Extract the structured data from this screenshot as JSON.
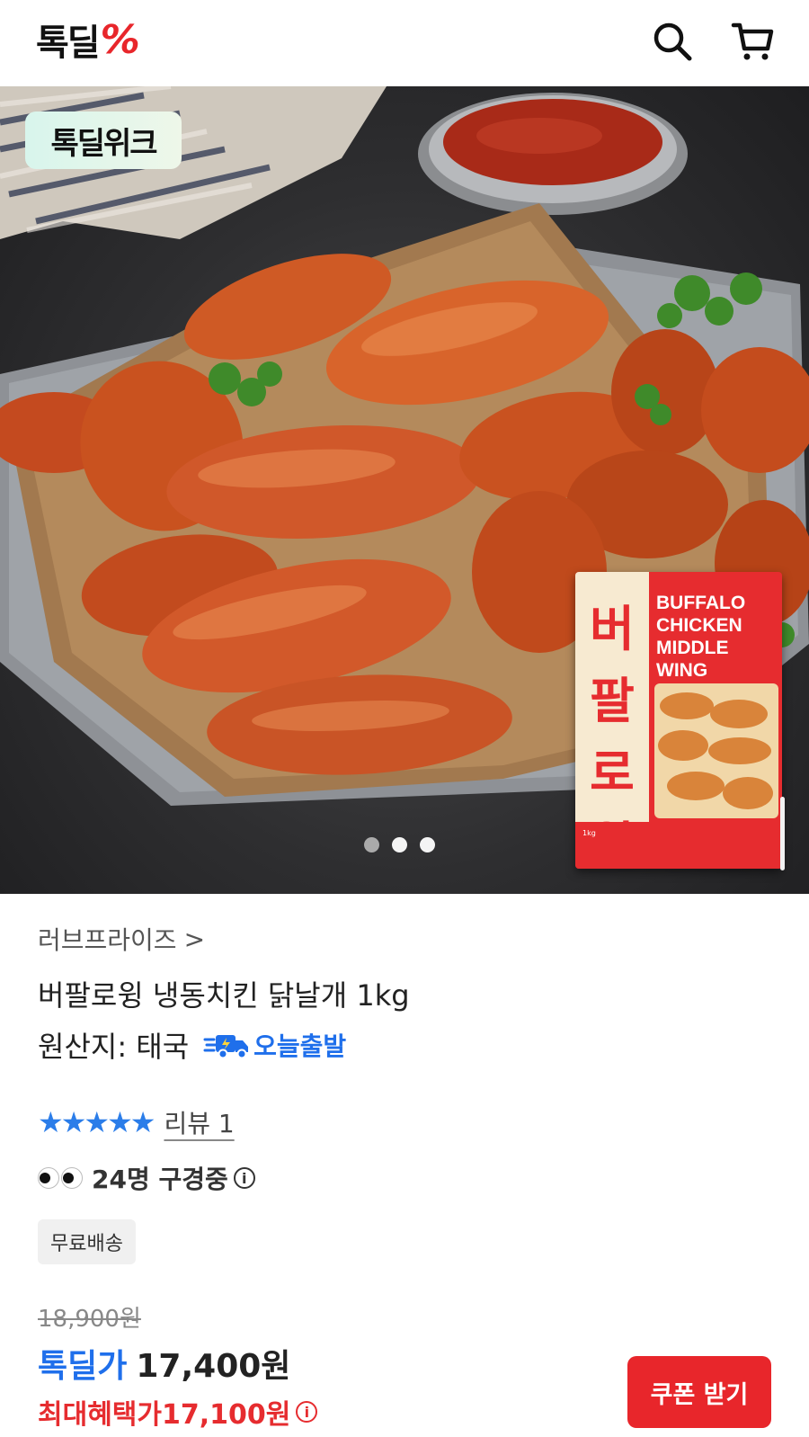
{
  "header": {
    "logo_text": "톡딜",
    "logo_mark": "%",
    "search_icon": "search-icon",
    "cart_icon": "cart-icon"
  },
  "hero": {
    "badge": "톡딜위크",
    "package": {
      "korean_text": "버팔로윙",
      "english_lines": [
        "BUFFALO",
        "CHICKEN",
        "MIDDLE",
        "WING"
      ],
      "weight": "1kg"
    },
    "carousel": {
      "pages": 3,
      "current_index": 1
    }
  },
  "product": {
    "seller": "러브프라이즈",
    "seller_chevron": ">",
    "title": "버팔로윙 냉동치킨 닭날개 1kg",
    "origin": "원산지: 태국",
    "shipping_badge": "오늘출발",
    "rating": 5,
    "stars": "★★★★★",
    "review_link": "리뷰 1",
    "watching": "24명 구경중",
    "info_glyph": "i",
    "free_shipping": "무료배송"
  },
  "price": {
    "original": "18,900원",
    "deal_label": "톡딜가",
    "deal_price": "17,400원",
    "max_benefit_label": "최대혜택가",
    "max_benefit_price": "17,100원"
  },
  "actions": {
    "coupon_button": "쿠폰 받기"
  },
  "colors": {
    "brand_red": "#e8262b",
    "accent_blue": "#1f6feb",
    "star_blue": "#2b7de9"
  }
}
